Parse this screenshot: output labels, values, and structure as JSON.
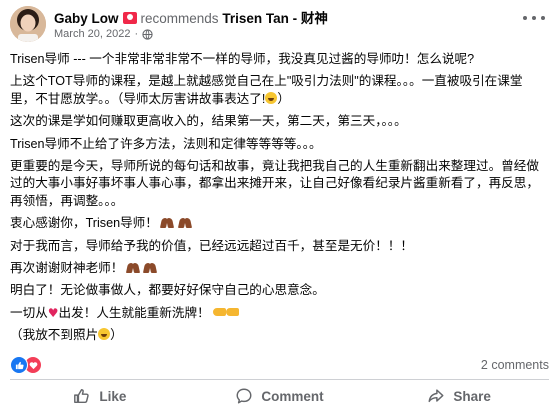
{
  "header": {
    "author": "Gaby Low",
    "recommends_text": "recommends",
    "page_name": "Trisen Tan - 财神",
    "date": "March 20, 2022",
    "separator": "·"
  },
  "body": {
    "paragraphs": [
      "Trisen导师 --- 一个非常非常非常不一样的导师，我没真见过酱的导师叻！怎么说呢?",
      "上这个TOT导师的课程，是越上就越感觉自己在上\"吸引力法则\"的课程。。。一直被吸引在课堂里，不甘愿放学。。（导师太厉害讲故事表达了!",
      "这次的课是学如何赚取更高收入的，结果第一天，第二天，第三天，。。。",
      "Trisen导师不止给了许多方法，法则和定律等等等等。。。",
      "更重要的是今天，导师所说的每句话和故事，竟让我把我自己的人生重新翻出来整理过。曾经做过的大事小事好事坏事人事心事，都拿出来摊开来，让自己好像看纪录片酱重新看了，再反思，再领悟，再调整。。。",
      "衷心感谢你，Trisen导师！",
      "对于我而言，导师给予我的价值，已经远远超过百千，甚至是无价！！！",
      "再次谢谢财神老师！",
      "明白了！无论做事做人，都要好好保守自己的心思意念。",
      "一切从",
      "出发！人生就能重新洗牌！",
      "（我放不到照片"
    ],
    "closing_paren": "）"
  },
  "reactions": {
    "comments": "2 comments"
  },
  "actions": {
    "like": "Like",
    "comment": "Comment",
    "share": "Share"
  },
  "icons": {
    "globe": "globe-icon",
    "more": "more-options-icon",
    "like": "thumbs-up-icon",
    "comment": "speech-bubble-icon",
    "share": "share-arrow-icon",
    "recommend_badge": "recommend-badge-icon"
  },
  "colors": {
    "like_blue": "#1877f2",
    "love_red": "#f33e58",
    "meta_gray": "#65676b",
    "divider": "#ced0d4"
  }
}
